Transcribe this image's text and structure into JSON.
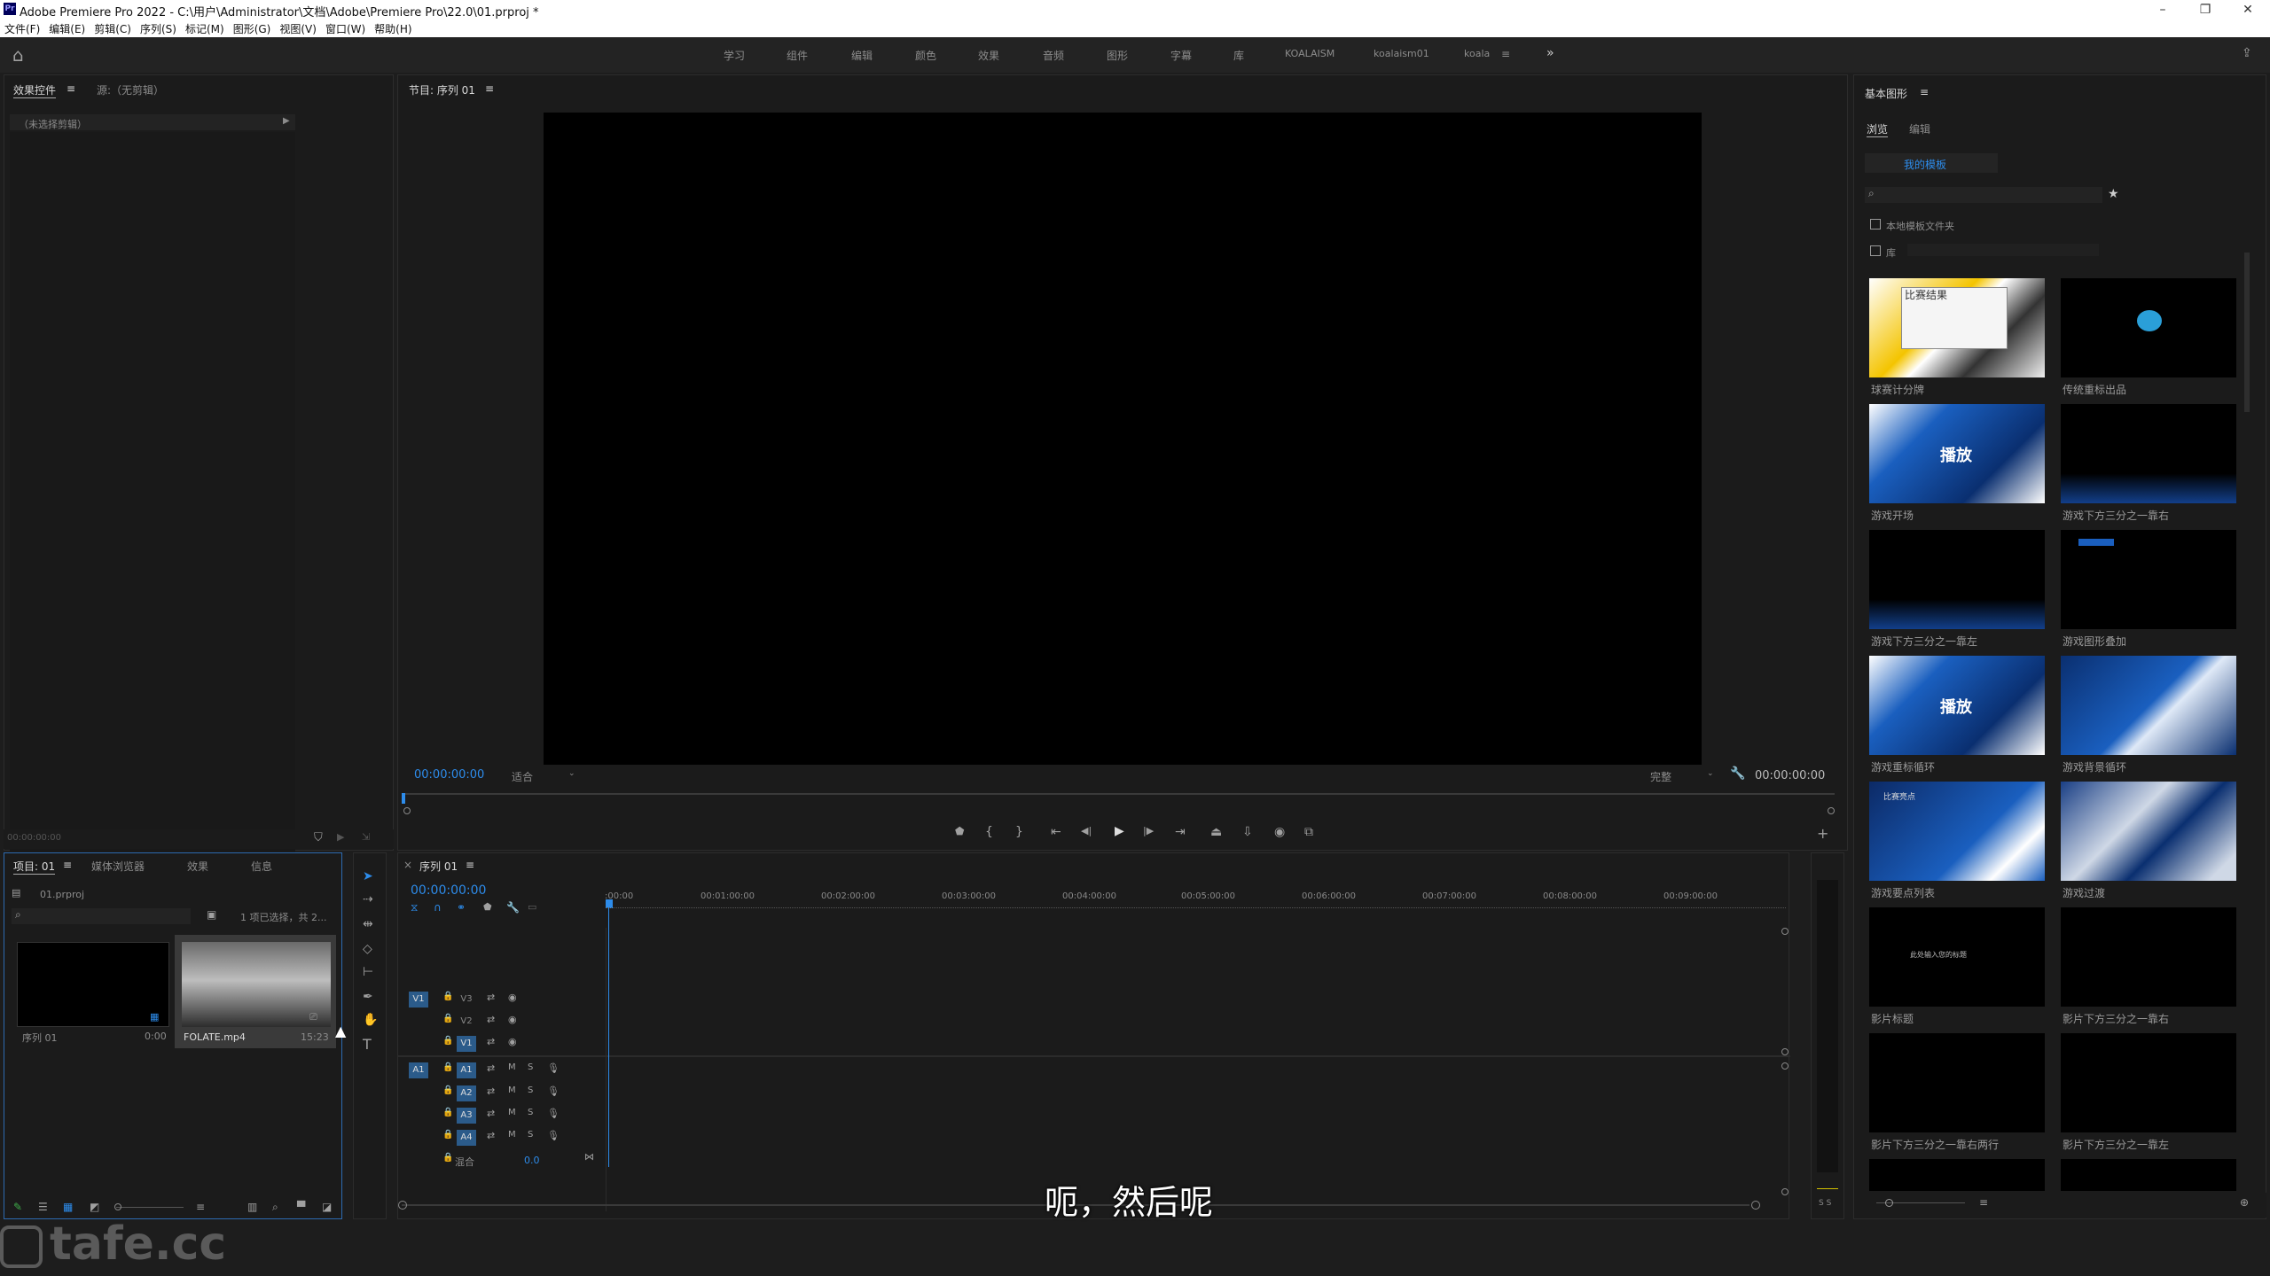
{
  "titlebar": {
    "title": "Adobe Premiere Pro 2022 - C:\\用户\\Administrator\\文档\\Adobe\\Premiere Pro\\22.0\\01.prproj *",
    "logo": "Pr"
  },
  "menu": [
    "文件(F)",
    "编辑(E)",
    "剪辑(C)",
    "序列(S)",
    "标记(M)",
    "图形(G)",
    "视图(V)",
    "窗口(W)",
    "帮助(H)"
  ],
  "workspaces": [
    "学习",
    "组件",
    "编辑",
    "颜色",
    "效果",
    "音频",
    "图形",
    "字幕",
    "库",
    "KOALAISM",
    "koalaism01",
    "koala"
  ],
  "effects_panel": {
    "tab_active": "效果控件",
    "tab2": "源:（无剪辑）",
    "no_clip": "（未选择剪辑）",
    "timecode": "00:00:00:00"
  },
  "program": {
    "title": "节目: 序列 01",
    "timecode_left": "00:00:00:00",
    "fit": "适合",
    "quality": "完整",
    "timecode_right": "00:00:00:00"
  },
  "project": {
    "tabs": [
      "项目: 01",
      "媒体浏览器",
      "效果",
      "信息"
    ],
    "file": "01.prproj",
    "selection": "1 项已选择，共 2...",
    "items": [
      {
        "name": "序列 01",
        "duration": "0:00"
      },
      {
        "name": "FOLATE.mp4",
        "duration": "15:23"
      }
    ]
  },
  "timeline": {
    "tab": "序列 01",
    "timecode": "00:00:00:00",
    "ruler": [
      ":00:00",
      "00:01:00:00",
      "00:02:00:00",
      "00:03:00:00",
      "00:04:00:00",
      "00:05:00:00",
      "00:06:00:00",
      "00:07:00:00",
      "00:08:00:00",
      "00:09:00:00"
    ],
    "video_tracks": [
      "V3",
      "V2",
      "V1"
    ],
    "audio_tracks": [
      "A1",
      "A2",
      "A3",
      "A4"
    ],
    "src_v": "V1",
    "src_a": "A1",
    "mix_label": "混合",
    "mix_value": "0.0",
    "meter_label": "S S"
  },
  "essential_graphics": {
    "title": "基本图形",
    "tab_browse": "浏览",
    "tab_edit": "编辑",
    "my_templates": "我的模板",
    "local_folder": "本地模板文件夹",
    "library": "库",
    "templates": [
      {
        "name": "球赛计分牌",
        "text": "比赛结果"
      },
      {
        "name": "传统重标出品",
        "text": ""
      },
      {
        "name": "游戏开场",
        "text": "播放"
      },
      {
        "name": "游戏下方三分之一靠右",
        "text": ""
      },
      {
        "name": "游戏下方三分之一靠左",
        "text": ""
      },
      {
        "name": "游戏图形叠加",
        "text": ""
      },
      {
        "name": "游戏重标循环",
        "text": "播放"
      },
      {
        "name": "游戏背景循环",
        "text": ""
      },
      {
        "name": "游戏要点列表",
        "text": "比赛亮点"
      },
      {
        "name": "游戏过渡",
        "text": ""
      },
      {
        "name": "影片标题",
        "text": "此处输入您的标题"
      },
      {
        "name": "影片下方三分之一靠右",
        "text": ""
      },
      {
        "name": "影片下方三分之一靠右两行",
        "text": ""
      },
      {
        "name": "影片下方三分之一靠左",
        "text": ""
      }
    ]
  },
  "subtitle": "呃，然后呢",
  "watermark": "tafe.cc",
  "colors": {
    "accent": "#2d8ceb",
    "panel": "#1b1b1b",
    "bg": "#1d1d1d"
  }
}
